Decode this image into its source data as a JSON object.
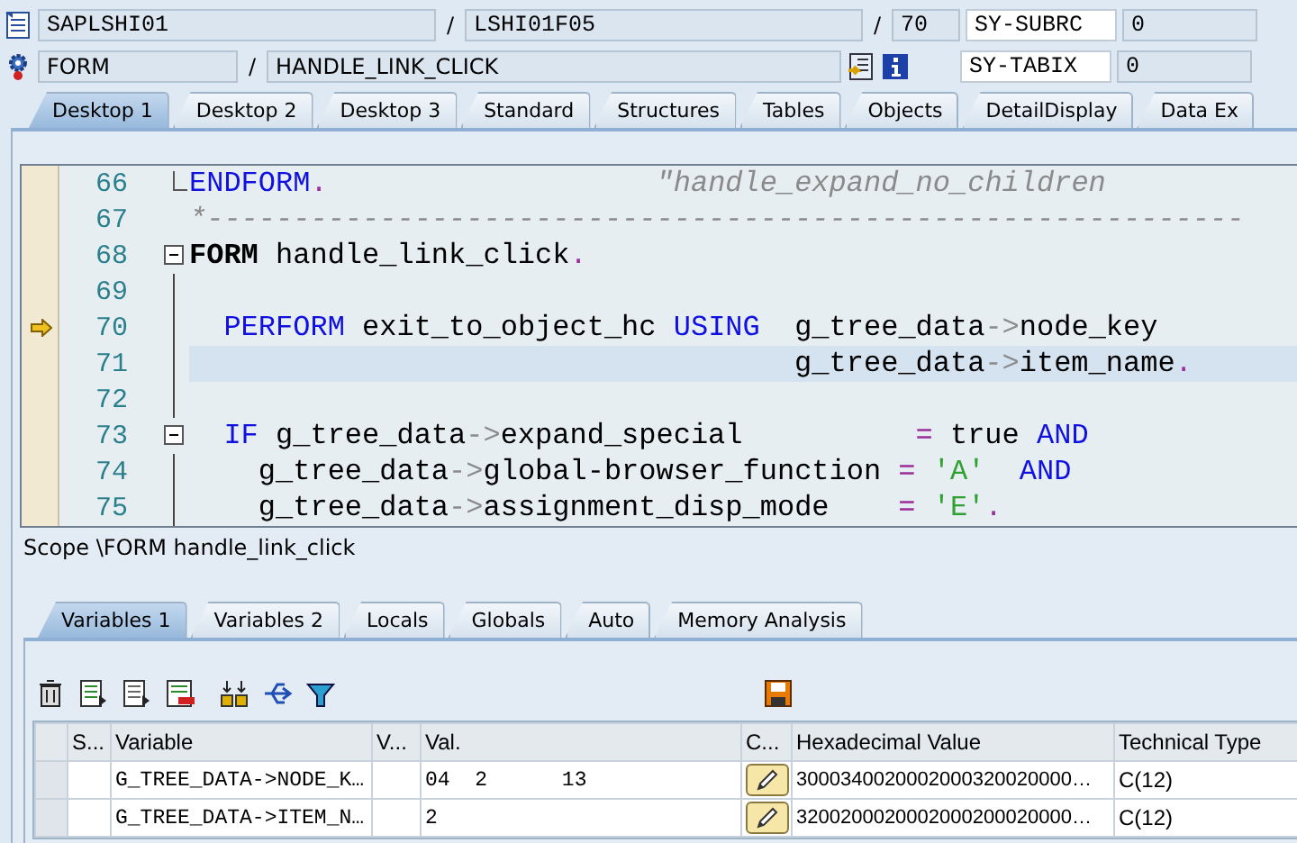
{
  "header_rows": [
    [
      {
        "kind": "program_icon"
      },
      {
        "kind": "field",
        "text": "SAPLSHI01"
      },
      {
        "kind": "separator",
        "text": "/"
      },
      {
        "kind": "field",
        "text": "LSHI01F05"
      },
      {
        "kind": "separator",
        "text": "/"
      },
      {
        "kind": "short_field",
        "text": "70"
      },
      {
        "kind": "name_field",
        "text": "SY-SUBRC"
      },
      {
        "kind": "value_field",
        "text": "0"
      }
    ],
    [
      {
        "kind": "event_icon"
      },
      {
        "kind": "event_type_field",
        "text": "FORM"
      },
      {
        "kind": "separator",
        "text": "/"
      },
      {
        "kind": "event_field",
        "text": "HANDLE_LINK_CLICK"
      },
      {
        "kind": "tool_icons"
      },
      {
        "kind": "name_field",
        "text": "SY-TABIX"
      },
      {
        "kind": "value_field",
        "text": "0"
      }
    ]
  ],
  "desktop_tabs": [
    {
      "label": "Desktop 1",
      "selected": true
    },
    {
      "label": "Desktop 2",
      "selected": false
    },
    {
      "label": "Desktop 3",
      "selected": false
    },
    {
      "label": "Standard",
      "selected": false
    },
    {
      "label": "Structures",
      "selected": false
    },
    {
      "label": "Tables",
      "selected": false
    },
    {
      "label": "Objects",
      "selected": false
    },
    {
      "label": "DetailDisplay",
      "selected": false
    },
    {
      "label": "Data Ex",
      "selected": false
    }
  ],
  "code_lines": [
    {
      "number": "66",
      "kind": "fold_end",
      "current": false,
      "highlighted": false,
      "segments": [
        {
          "kind": "keyword",
          "text": "ENDFORM"
        },
        {
          "kind": "operator",
          "text": "."
        },
        {
          "kind": "comment",
          "text": "                   \"handle_expand_no_children"
        }
      ]
    },
    {
      "number": "67",
      "kind": "plain",
      "current": false,
      "highlighted": false,
      "segments": [
        {
          "kind": "comment",
          "text": "*------------------------------------------------------------"
        }
      ]
    },
    {
      "number": "68",
      "kind": "fold_start",
      "current": false,
      "highlighted": false,
      "segments": [
        {
          "kind": "bold",
          "text": "FORM"
        },
        {
          "kind": "text",
          "text": " handle_link_click"
        },
        {
          "kind": "operator",
          "text": "."
        }
      ]
    },
    {
      "number": "69",
      "kind": "block",
      "current": false,
      "highlighted": false
    },
    {
      "number": "70",
      "kind": "block",
      "current": true,
      "highlighted": false,
      "segments": [
        {
          "kind": "keyword",
          "text": "  PERFORM"
        },
        {
          "kind": "text",
          "text": " exit_to_object_hc "
        },
        {
          "kind": "keyword",
          "text": "USING"
        },
        {
          "kind": "text",
          "text": "  g_tree_data"
        },
        {
          "kind": "arrow",
          "text": "->"
        },
        {
          "kind": "text",
          "text": "node_key"
        }
      ]
    },
    {
      "number": "71",
      "kind": "block",
      "current": false,
      "highlighted": true,
      "segments": [
        {
          "kind": "text",
          "text": "                                   g_tree_data"
        },
        {
          "kind": "arrow",
          "text": "->"
        },
        {
          "kind": "text",
          "text": "item_name"
        },
        {
          "kind": "operator",
          "text": "."
        }
      ]
    },
    {
      "number": "72",
      "kind": "block",
      "current": false,
      "highlighted": false
    },
    {
      "number": "73",
      "kind": "fold_start",
      "current": false,
      "highlighted": false,
      "segments": [
        {
          "kind": "keyword",
          "text": "  IF"
        },
        {
          "kind": "text",
          "text": " g_tree_data"
        },
        {
          "kind": "arrow",
          "text": "->"
        },
        {
          "kind": "text",
          "text": "expand_special"
        },
        {
          "kind": "operator",
          "text": "          ="
        },
        {
          "kind": "text",
          "text": " true"
        },
        {
          "kind": "keyword",
          "text": " AND"
        }
      ]
    },
    {
      "number": "74",
      "kind": "block",
      "current": false,
      "highlighted": false,
      "segments": [
        {
          "kind": "text",
          "text": "    g_tree_data"
        },
        {
          "kind": "arrow",
          "text": "->"
        },
        {
          "kind": "text",
          "text": "global-browser_function"
        },
        {
          "kind": "operator",
          "text": " ="
        },
        {
          "kind": "literal",
          "text": " 'A'"
        },
        {
          "kind": "keyword",
          "text": "  AND"
        }
      ]
    },
    {
      "number": "75",
      "kind": "block",
      "current": false,
      "highlighted": false,
      "segments": [
        {
          "kind": "text",
          "text": "    g_tree_data"
        },
        {
          "kind": "arrow",
          "text": "->"
        },
        {
          "kind": "text",
          "text": "assignment_disp_mode"
        },
        {
          "kind": "operator",
          "text": "    ="
        },
        {
          "kind": "literal",
          "text": " 'E'"
        },
        {
          "kind": "operator",
          "text": "."
        }
      ]
    }
  ],
  "scope": "Scope \\FORM handle_link_click",
  "variable_tabs": [
    {
      "label": "Variables 1",
      "selected": true
    },
    {
      "label": "Variables 2",
      "selected": false
    },
    {
      "label": "Locals",
      "selected": false
    },
    {
      "label": "Globals",
      "selected": false
    },
    {
      "label": "Auto",
      "selected": false
    },
    {
      "label": "Memory Analysis",
      "selected": false
    }
  ],
  "table": {
    "columns": [
      "S...",
      "Variable",
      "V...",
      "Val.",
      "C...",
      "Hexadecimal Value",
      "Technical Type"
    ],
    "rows": [
      {
        "variable": "G_TREE_DATA->NODE_K…",
        "value": "04  2      13",
        "hex": "3000340020002000320020000…",
        "type": "C(12)"
      },
      {
        "variable": "G_TREE_DATA->ITEM_N…",
        "value": "2",
        "hex": "3200200020002000200020000…",
        "type": "C(12)"
      }
    ]
  }
}
